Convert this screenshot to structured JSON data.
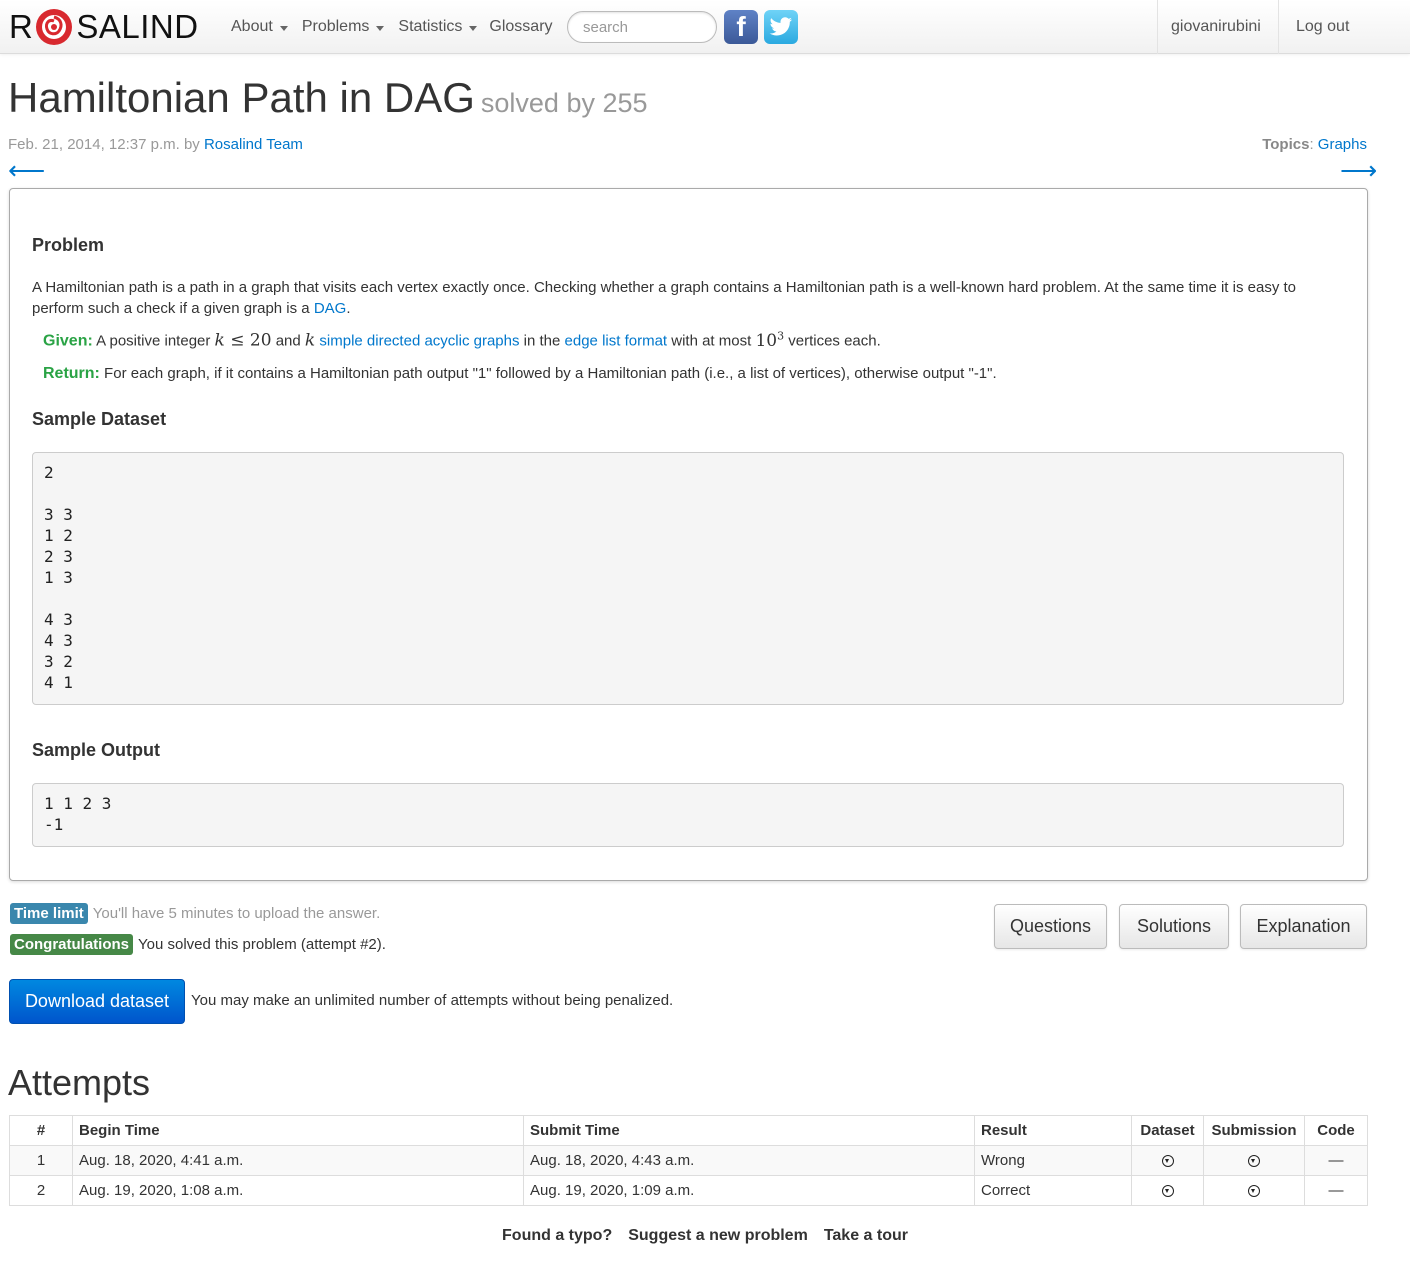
{
  "nav": {
    "brand_left": "R",
    "brand_right": "SALIND",
    "items": [
      {
        "label": "About",
        "dropdown": true
      },
      {
        "label": "Problems",
        "dropdown": true
      },
      {
        "label": "Statistics",
        "dropdown": true
      },
      {
        "label": "Glossary",
        "dropdown": false
      }
    ],
    "search_placeholder": "search",
    "facebook_icon": "f",
    "user": "giovanirubini",
    "logout": "Log out"
  },
  "header": {
    "title": "Hamiltonian Path in DAG",
    "solved_by": "solved by 255",
    "date": "Feb. 21, 2014, 12:37 p.m. by ",
    "author": "Rosalind Team",
    "topics_label": "Topics",
    "topics_sep": ": ",
    "topic": "Graphs",
    "prev_arrow": "⟵",
    "next_arrow": "⟶"
  },
  "problem": {
    "heading": "Problem",
    "text_before": "A Hamiltonian path is a path in a graph that visits each vertex exactly once. Checking whether a graph contains a Hamiltonian path is a well-known hard problem. At the same time it is easy to perform such a check if a given graph is a ",
    "dag_link": "DAG",
    "text_after": ".",
    "given_label": "Given:",
    "given_1": " A positive integer ",
    "given_k": "k",
    "given_le": " ≤ 20",
    "given_2": " and ",
    "given_3": " ",
    "given_link1": "simple directed acyclic graphs",
    "given_4": " in the ",
    "given_link2": "edge list format",
    "given_5": " with at most ",
    "given_pow_base": "10",
    "given_pow_exp": "3",
    "given_6": " vertices each.",
    "return_label": "Return:",
    "return_text": " For each graph, if it contains a Hamiltonian path output \"1\" followed by a Hamiltonian path (i.e., a list of vertices), otherwise output \"-1\".",
    "sample_dataset_heading": "Sample Dataset",
    "sample_dataset": "2\n\n3 3\n1 2\n2 3\n1 3\n\n4 3\n4 3\n3 2\n4 1",
    "sample_output_heading": "Sample Output",
    "sample_output": "1 1 2 3\n-1"
  },
  "status": {
    "time_limit_label": "Time limit",
    "time_limit_text": "You'll have 5 minutes to upload the answer.",
    "congrats_label": "Congratulations",
    "congrats_text": "You solved this problem (attempt #2).",
    "download_button": "Download dataset",
    "download_note": "You may make an unlimited number of attempts without being penalized."
  },
  "buttons": {
    "questions": "Questions",
    "solutions": "Solutions",
    "explanation": "Explanation"
  },
  "attempts": {
    "heading": "Attempts",
    "columns": [
      "#",
      "Begin Time",
      "Submit Time",
      "Result",
      "Dataset",
      "Submission",
      "Code"
    ],
    "rows": [
      {
        "num": "1",
        "begin": "Aug. 18, 2020, 4:41 a.m.",
        "submit": "Aug. 18, 2020, 4:43 a.m.",
        "result": "Wrong",
        "code": "—"
      },
      {
        "num": "2",
        "begin": "Aug. 19, 2020, 1:08 a.m.",
        "submit": "Aug. 19, 2020, 1:09 a.m.",
        "result": "Correct",
        "code": "—"
      }
    ]
  },
  "footer": {
    "typo": "Found a typo?",
    "suggest": "Suggest a new problem",
    "tour": "Take a tour"
  }
}
